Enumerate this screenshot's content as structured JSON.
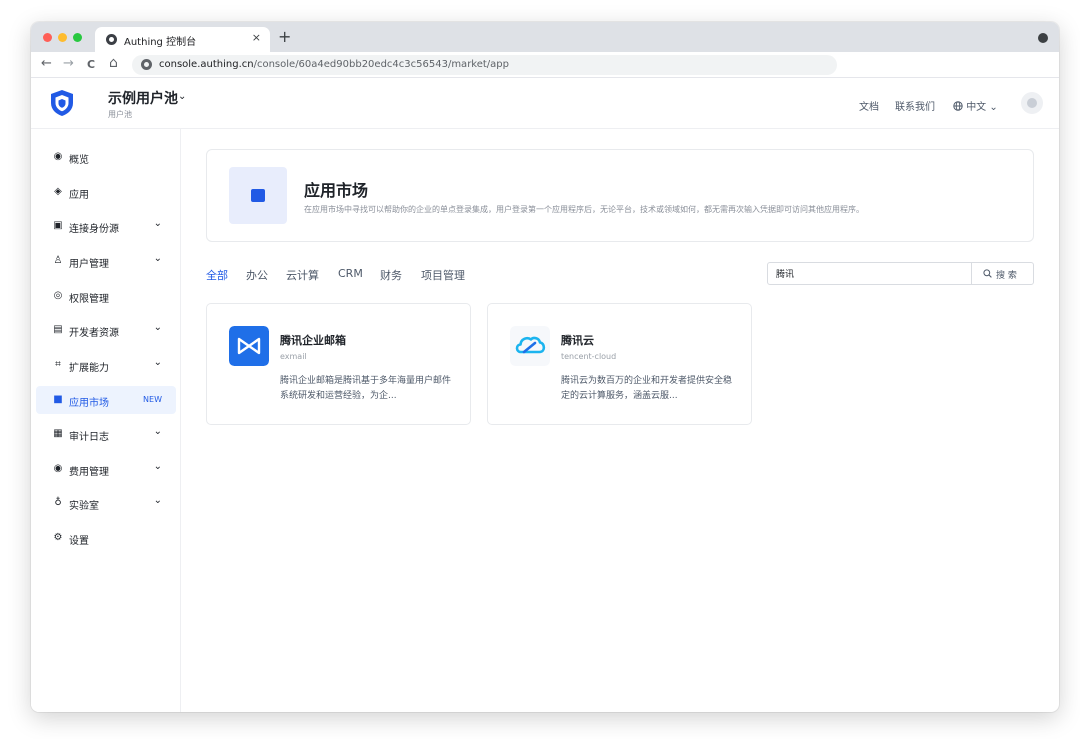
{
  "browser": {
    "tab_title": "Authing 控制台",
    "tab_close": "×",
    "new_tab": "+",
    "url_host": "console.authing.cn",
    "url_path": "/console/60a4ed90bb20edc4c3c56543/market/app",
    "back": "←",
    "forward": "→",
    "reload": "C",
    "home": "⌂"
  },
  "header": {
    "pool_title": "示例用户池",
    "pool_subtitle": "用户池",
    "docs": "文档",
    "contact": "联系我们",
    "language": "中文",
    "language_icon": "globe-icon",
    "caret": "⌄"
  },
  "sidebar": {
    "items": [
      {
        "label": "概览",
        "icon": "gauge-icon",
        "glyph": "◉"
      },
      {
        "label": "应用",
        "icon": "apps-icon",
        "glyph": "◈"
      },
      {
        "label": "连接身份源",
        "icon": "connection-icon",
        "glyph": "▣",
        "chevron": "⌄"
      },
      {
        "label": "用户管理",
        "icon": "users-icon",
        "glyph": "♙",
        "chevron": "⌄"
      },
      {
        "label": "权限管理",
        "icon": "permission-icon",
        "glyph": "◎"
      },
      {
        "label": "开发者资源",
        "icon": "developer-icon",
        "glyph": "▤",
        "chevron": "⌄"
      },
      {
        "label": "扩展能力",
        "icon": "extension-icon",
        "glyph": "⌗",
        "chevron": "⌄"
      },
      {
        "label": "应用市场",
        "icon": "market-icon",
        "glyph": "■",
        "badge": "NEW"
      },
      {
        "label": "审计日志",
        "icon": "audit-log-icon",
        "glyph": "▦",
        "chevron": "⌄"
      },
      {
        "label": "费用管理",
        "icon": "billing-icon",
        "glyph": "◉",
        "chevron": "⌄"
      },
      {
        "label": "实验室",
        "icon": "lab-icon",
        "glyph": "♁",
        "chevron": "⌄"
      },
      {
        "label": "设置",
        "icon": "settings-icon",
        "glyph": "⚙"
      }
    ]
  },
  "banner": {
    "title": "应用市场",
    "description": "在应用市场中寻找可以帮助你的企业的单点登录集成，用户登录第一个应用程序后，无论平台，技术或领域如何，都无需再次输入凭据即可访问其他应用程序。"
  },
  "filters": [
    "全部",
    "办公",
    "云计算",
    "CRM",
    "财务",
    "项目管理"
  ],
  "search": {
    "value": "腾讯",
    "button_label": "搜 索",
    "button_icon": "search-icon"
  },
  "cards": [
    {
      "name": "腾讯企业邮箱",
      "id": "exmail",
      "description": "腾讯企业邮箱是腾讯基于多年海量用户邮件系统研发和运营经验，为企...",
      "logo_icon": "exmail-logo-icon"
    },
    {
      "name": "腾讯云",
      "id": "tencent-cloud",
      "description": "腾讯云为数百万的企业和开发者提供安全稳定的云计算服务，涵盖云服...",
      "logo_icon": "tencent-cloud-logo-icon"
    }
  ],
  "colors": {
    "accent": "#215ae5",
    "active_bg": "#edf3fe",
    "exmail_blue": "#1f6fe8",
    "cloud_blue": "#1bb4ef"
  }
}
